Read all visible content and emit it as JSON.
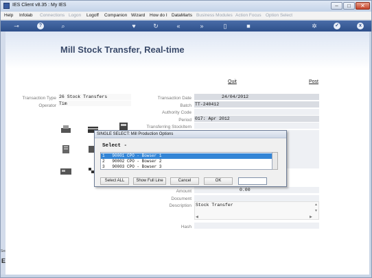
{
  "window": {
    "title": "IES Client v8.35 : My IES"
  },
  "menu": [
    {
      "label": "Help",
      "dim": false
    },
    {
      "label": "Infolab",
      "dim": false
    },
    {
      "label": "Connections",
      "dim": true
    },
    {
      "label": "Logon",
      "dim": true
    },
    {
      "label": "Logoff",
      "dim": false
    },
    {
      "label": "Companion",
      "dim": false
    },
    {
      "label": "Wizard",
      "dim": false
    },
    {
      "label": "How do I",
      "dim": false
    },
    {
      "label": "DataMarts",
      "dim": false
    },
    {
      "label": "Business Modules",
      "dim": true
    },
    {
      "label": "Action Focus",
      "dim": true
    },
    {
      "label": "Option Select",
      "dim": true
    }
  ],
  "toolbar": {
    "icons": [
      "key-icon",
      "help-icon",
      "search-icon",
      "heart-icon",
      "refresh-icon",
      "rewind-icon",
      "fast-forward-icon",
      "document-icon",
      "stop-icon",
      "settings-icon",
      "check-icon",
      "close-icon"
    ],
    "help_glyph": "?",
    "close_glyph": "x"
  },
  "page": {
    "title": "Mill Stock Transfer, Real-time",
    "quit_label": "Quit",
    "post_label": "Post"
  },
  "form": {
    "transaction_type_label": "Transaction Type",
    "transaction_type_value": "26 Stock Transfers",
    "operator_label": "Operator",
    "operator_value": "Tim",
    "transaction_date_label": "Transaction Date",
    "transaction_date_value": "24/04/2012",
    "batch_label": "Batch",
    "batch_value": "TT-240412",
    "authority_code_label": "Authority Code",
    "authority_code_value": "",
    "period_label": "Period",
    "period_value": "017: Apr 2012",
    "transferring_label": "Transferring StockItem",
    "amount_label": "Amount",
    "amount_value": "0.00",
    "document_label": "Document",
    "document_value": "",
    "description_label": "Description",
    "description_value": "Stock Transfer",
    "hash_label": "Hash",
    "hash_value": ""
  },
  "modal": {
    "title": "SINGLE SELECT: Mill Production Options",
    "heading": "Select -",
    "rows": [
      {
        "text": "1   90001 CPO - Bowser 1",
        "selected": true
      },
      {
        "text": "2   90002 CPO - Bowser 2",
        "selected": false
      },
      {
        "text": "3   90003 CPO - Bowser 3",
        "selected": false
      }
    ],
    "buttons": {
      "select_all": "Select ALL",
      "show_full_line": "Show Full Line",
      "cancel": "Cancel",
      "ok": "OK"
    }
  },
  "statusbar": {
    "ses_label": "Ses",
    "big_glyph": "E"
  },
  "colors": {
    "toolbar": "#2d4f8a",
    "selection": "#3385d6",
    "title": "#3a4a6a"
  }
}
